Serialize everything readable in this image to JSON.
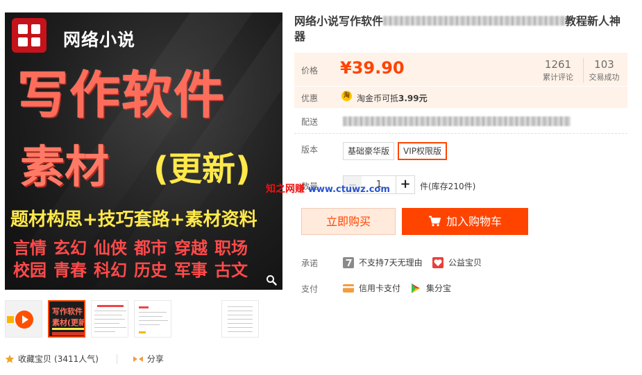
{
  "product_image": {
    "brand_text": "网络小说",
    "headline": "写作软件",
    "subline_main": "素材",
    "subline_tag": "(更新)",
    "band_text": "题材构思+技巧套路+素材资料",
    "genre_tags": [
      "言情",
      "玄幻",
      "仙侠",
      "都市",
      "穿越",
      "职场",
      "校园",
      "青春",
      "科幻",
      "历史",
      "军事",
      "古文"
    ]
  },
  "thumbnails": {
    "thumb_1_line1": "写作软件",
    "thumb_1_line2": "素材(更新)"
  },
  "favorites": {
    "label": "收藏宝贝",
    "count": "(3411人气)",
    "share_label": "分享"
  },
  "title": {
    "prefix": "网络小说写作软件",
    "suffix": "教程新人神器"
  },
  "price": {
    "label": "价格",
    "value": "¥39.90",
    "reviews_count": "1261",
    "reviews_caption": "累计评论",
    "deals_count": "103",
    "deals_caption": "交易成功"
  },
  "promo": {
    "label": "优惠",
    "coin_glyph": "淘",
    "text": "淘金币可抵",
    "amount": "3.99元"
  },
  "shipping": {
    "label": "配送"
  },
  "edition": {
    "label": "版本",
    "options": [
      "基础豪华版",
      "VIP权限版"
    ],
    "selected": "VIP权限版"
  },
  "quantity": {
    "label": "数量",
    "minus": "−",
    "value": "1",
    "plus": "+",
    "stock": "件(库存210件)"
  },
  "watermark": {
    "text": "知之网赚",
    "url": "www.ctuwz.com"
  },
  "actions": {
    "buy_now": "立即购买",
    "add_to_cart": "加入购物车"
  },
  "promise": {
    "label": "承诺",
    "items": [
      "不支持7天无理由",
      "公益宝贝"
    ]
  },
  "payment": {
    "label": "支付",
    "items": [
      "信用卡支付",
      "集分宝"
    ]
  },
  "colors": {
    "accent": "#ff4400",
    "price_bg": "#fff2e8",
    "buy_now_bg": "#ffeadb"
  }
}
